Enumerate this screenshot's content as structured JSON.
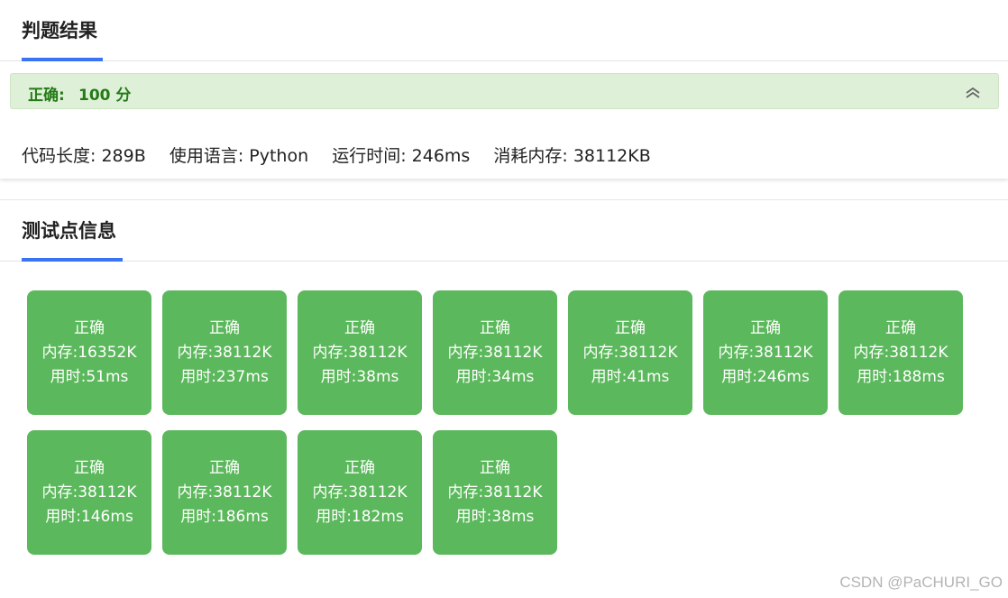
{
  "result_panel": {
    "title": "判题结果",
    "status": "正确:",
    "score": "100 分",
    "stats": [
      {
        "label": "代码长度:",
        "value": "289B"
      },
      {
        "label": "使用语言:",
        "value": "Python"
      },
      {
        "label": "运行时间:",
        "value": "246ms"
      },
      {
        "label": "消耗内存:",
        "value": "38112KB"
      }
    ]
  },
  "testcases_panel": {
    "title": "测试点信息",
    "cases": [
      {
        "status": "正确",
        "memory": "内存:16352K",
        "time": "用时:51ms"
      },
      {
        "status": "正确",
        "memory": "内存:38112K",
        "time": "用时:237ms"
      },
      {
        "status": "正确",
        "memory": "内存:38112K",
        "time": "用时:38ms"
      },
      {
        "status": "正确",
        "memory": "内存:38112K",
        "time": "用时:34ms"
      },
      {
        "status": "正确",
        "memory": "内存:38112K",
        "time": "用时:41ms"
      },
      {
        "status": "正确",
        "memory": "内存:38112K",
        "time": "用时:246ms"
      },
      {
        "status": "正确",
        "memory": "内存:38112K",
        "time": "用时:188ms"
      },
      {
        "status": "正确",
        "memory": "内存:38112K",
        "time": "用时:146ms"
      },
      {
        "status": "正确",
        "memory": "内存:38112K",
        "time": "用时:186ms"
      },
      {
        "status": "正确",
        "memory": "内存:38112K",
        "time": "用时:182ms"
      },
      {
        "status": "正确",
        "memory": "内存:38112K",
        "time": "用时:38ms"
      }
    ]
  },
  "watermark": "CSDN @PaCHURI_GO",
  "colors": {
    "accent": "#3b74f3",
    "success_bg": "#dff0d8",
    "success_text": "#247a16",
    "testcase_bg": "#5cb85c"
  },
  "icons": {
    "collapse": "double-chevron-up-icon"
  }
}
